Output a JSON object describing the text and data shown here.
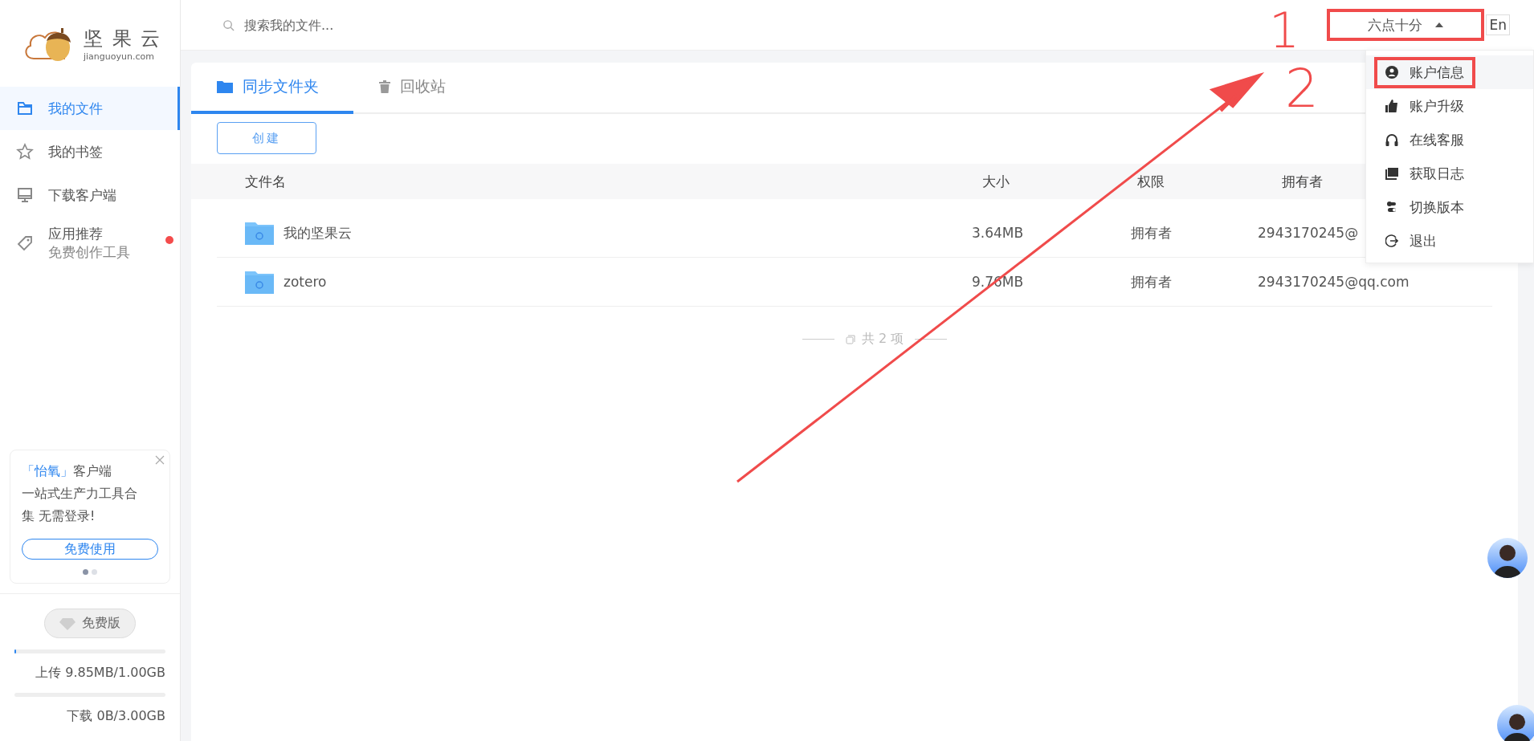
{
  "logo": {
    "name": "坚 果 云",
    "domain": "jianguoyun.com"
  },
  "search": {
    "placeholder": "搜索我的文件..."
  },
  "user_menu": {
    "label": "六点十分",
    "expanded": true,
    "annotated": true
  },
  "language_button": "En",
  "sidebar": {
    "items": [
      {
        "kind": "folder",
        "label": "我的文件",
        "selected": true
      },
      {
        "kind": "star",
        "label": "我的书签",
        "selected": false
      },
      {
        "kind": "monitor",
        "label": "下载客户端",
        "selected": false
      },
      {
        "kind": "tag",
        "label": "应用推荐",
        "sublabel": "免费创作工具",
        "selected": false,
        "badge": true
      }
    ]
  },
  "promo": {
    "highlight": "「怡氧」",
    "title": "客户端",
    "text": "一站式生产力工具合集 无需登录!",
    "button": "免费使用",
    "dots": [
      {
        "selected": true
      },
      {
        "selected": false
      }
    ]
  },
  "plan": {
    "label": "免费版"
  },
  "storage": [
    {
      "label": "上传 9.85MB/1.00GB",
      "level": 0.01
    },
    {
      "label": "下载 0B/3.00GB",
      "level": 0
    }
  ],
  "tabs": [
    {
      "kind": "folder",
      "label": "同步文件夹",
      "selected": true
    },
    {
      "kind": "trash",
      "label": "回收站",
      "selected": false
    }
  ],
  "create_button": "创建",
  "table": {
    "columns": [
      "文件名",
      "大小",
      "权限",
      "拥有者"
    ],
    "rows": [
      {
        "name": "我的坚果云",
        "size": "3.64MB",
        "permission": "拥有者",
        "owner": "2943170245@"
      },
      {
        "name": "zotero",
        "size": "9.76MB",
        "permission": "拥有者",
        "owner": "2943170245@qq.com"
      }
    ]
  },
  "footer": "共 2 项",
  "dropdown": [
    {
      "kind": "user",
      "label": "账户信息",
      "selected": true,
      "annotated": true
    },
    {
      "kind": "thumb",
      "label": "账户升级",
      "selected": false,
      "annotated": false
    },
    {
      "kind": "headset",
      "label": "在线客服",
      "selected": false,
      "annotated": false
    },
    {
      "kind": "log",
      "label": "获取日志",
      "selected": false,
      "annotated": false
    },
    {
      "kind": "switch",
      "label": "切换版本",
      "selected": false,
      "annotated": false
    },
    {
      "kind": "logout",
      "label": "退出",
      "selected": false,
      "annotated": false
    }
  ],
  "annotations": [
    {
      "kind": "digit",
      "text": "1"
    },
    {
      "kind": "digit",
      "text": "2"
    },
    {
      "kind": "arrow"
    }
  ]
}
